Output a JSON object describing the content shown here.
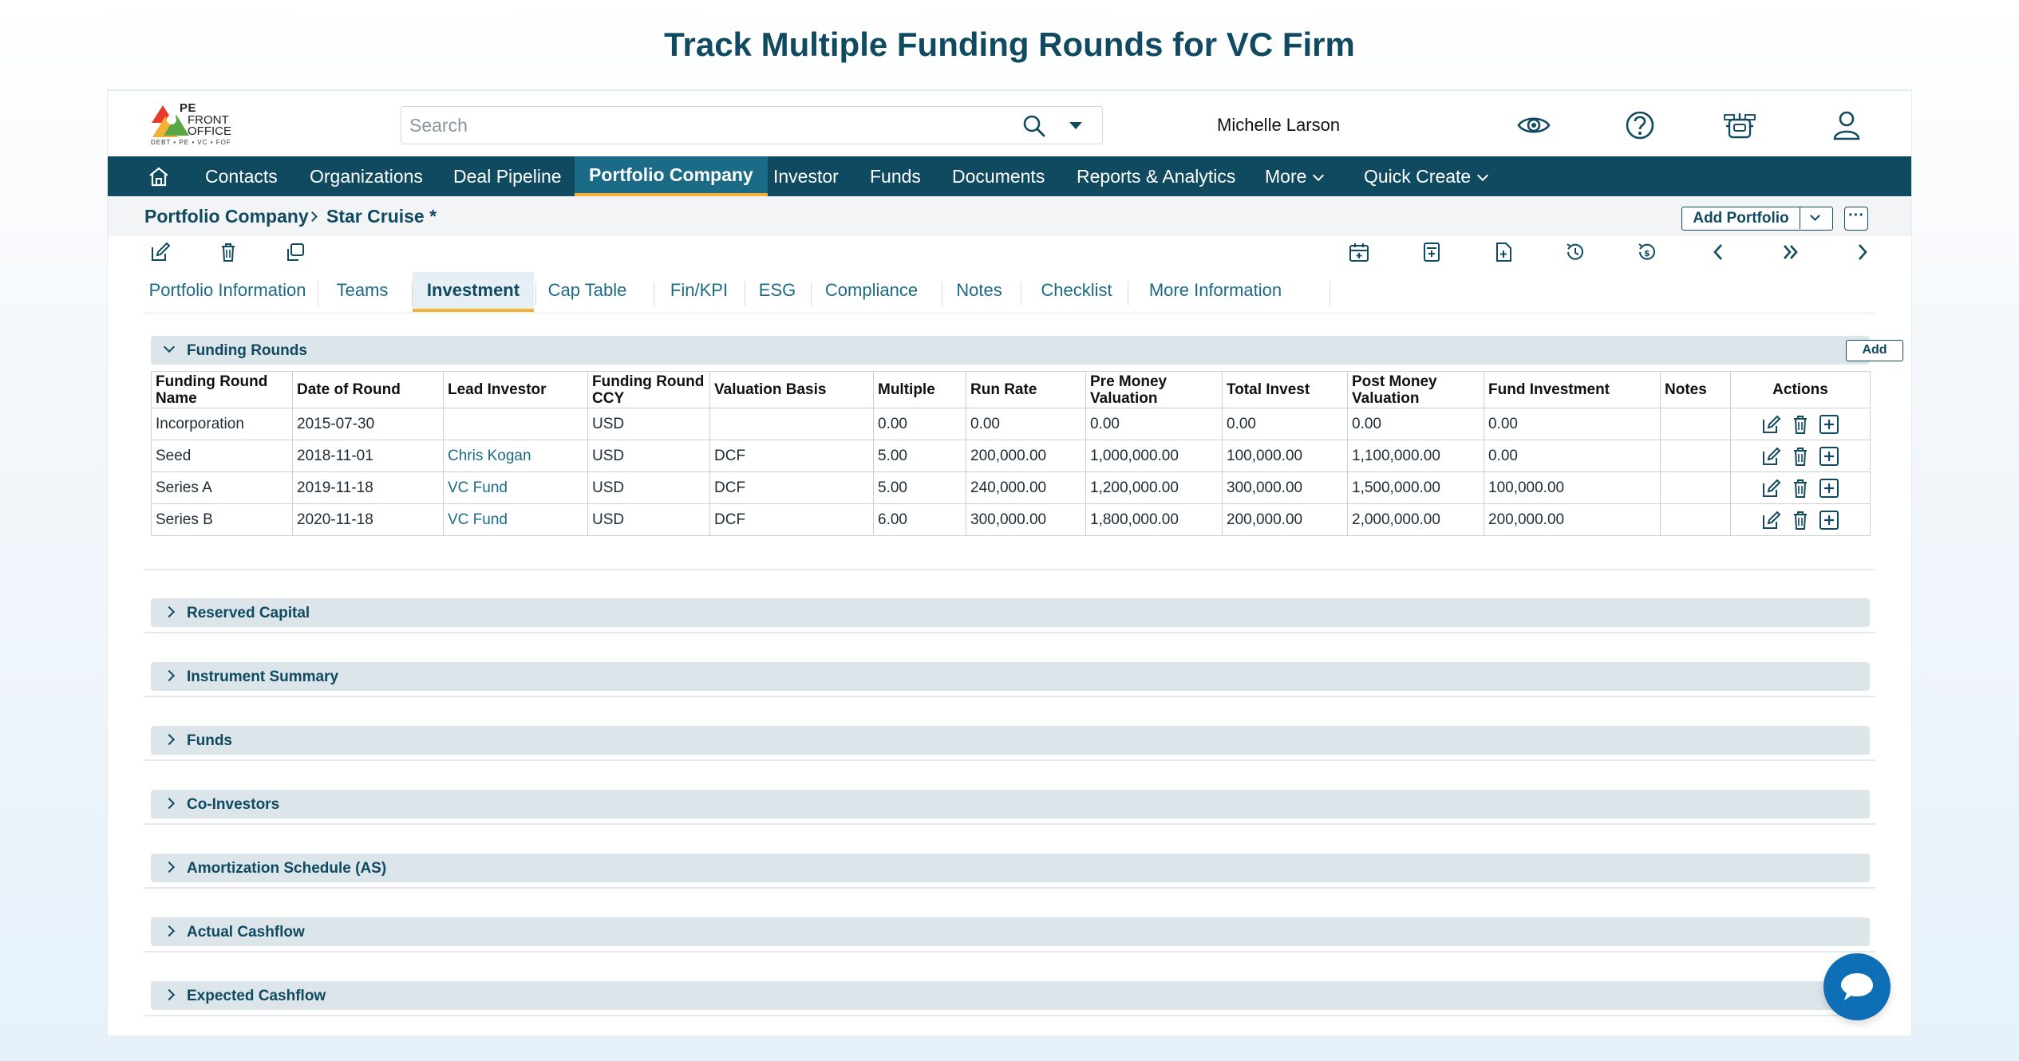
{
  "page_title": "Track Multiple Funding Rounds for VC Firm",
  "logo": {
    "line1": "PE",
    "line2": "FRONT",
    "line3": "OFFICE",
    "tagline": "DEBT • PE • VC • FOF"
  },
  "search": {
    "placeholder": "Search"
  },
  "user": {
    "name": "Michelle Larson"
  },
  "nav": {
    "items": [
      "Contacts",
      "Organizations",
      "Deal Pipeline",
      "Portfolio Company",
      "Investor",
      "Funds",
      "Documents",
      "Reports & Analytics",
      "More",
      "Quick Create"
    ],
    "active": "Portfolio Company"
  },
  "breadcrumb": {
    "root": "Portfolio Company",
    "current": "Star Cruise *"
  },
  "actions": {
    "add_portfolio": "Add Portfolio",
    "more": "···"
  },
  "tabs": [
    "Portfolio Information",
    "Teams",
    "Investment",
    "Cap Table",
    "Fin/KPI",
    "ESG",
    "Compliance",
    "Notes",
    "Checklist",
    "More Information"
  ],
  "active_tab": "Investment",
  "funding_rounds": {
    "title": "Funding Rounds",
    "add_label": "Add",
    "headers": [
      "Funding Round Name",
      "Date of Round",
      "Lead Investor",
      "Funding Round CCY",
      "Valuation Basis",
      "Multiple",
      "Run Rate",
      "Pre Money Valuation",
      "Total Invest",
      "Post Money Valuation",
      "Fund Investment",
      "Notes",
      "Actions"
    ],
    "rows": [
      {
        "name": "Incorporation",
        "date": "2015-07-30",
        "lead": "",
        "ccy": "USD",
        "basis": "",
        "multiple": "0.00",
        "run_rate": "0.00",
        "pre_money": "0.00",
        "total_invest": "0.00",
        "post_money": "0.00",
        "fund_investment": "0.00",
        "notes": ""
      },
      {
        "name": "Seed",
        "date": "2018-11-01",
        "lead": "Chris Kogan",
        "ccy": "USD",
        "basis": "DCF",
        "multiple": "5.00",
        "run_rate": "200,000.00",
        "pre_money": "1,000,000.00",
        "total_invest": "100,000.00",
        "post_money": "1,100,000.00",
        "fund_investment": "0.00",
        "notes": ""
      },
      {
        "name": "Series A",
        "date": "2019-11-18",
        "lead": "VC Fund",
        "ccy": "USD",
        "basis": "DCF",
        "multiple": "5.00",
        "run_rate": "240,000.00",
        "pre_money": "1,200,000.00",
        "total_invest": "300,000.00",
        "post_money": "1,500,000.00",
        "fund_investment": "100,000.00",
        "notes": ""
      },
      {
        "name": "Series B",
        "date": "2020-11-18",
        "lead": "VC Fund",
        "ccy": "USD",
        "basis": "DCF",
        "multiple": "6.00",
        "run_rate": "300,000.00",
        "pre_money": "1,800,000.00",
        "total_invest": "200,000.00",
        "post_money": "2,000,000.00",
        "fund_investment": "200,000.00",
        "notes": ""
      }
    ]
  },
  "sections": [
    "Reserved Capital",
    "Instrument Summary",
    "Funds",
    "Co-Investors",
    "Amortization Schedule (AS)",
    "Actual Cashflow",
    "Expected Cashflow"
  ],
  "colors": {
    "brand": "#0f4a60",
    "accent": "#f3b234",
    "link": "#1b6b86",
    "chat": "#0f6fb6"
  }
}
